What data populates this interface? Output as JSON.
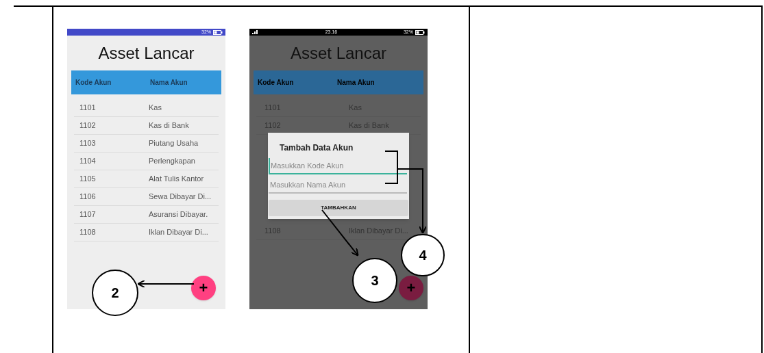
{
  "screens": [
    {
      "kind": "list",
      "status_bar": {
        "battery": "32%"
      },
      "title": "Asset Lancar",
      "columns": [
        "Kode Akun",
        "Nama Akun"
      ],
      "rows": [
        {
          "code": "1101",
          "name": "Kas"
        },
        {
          "code": "1102",
          "name": "Kas di Bank"
        },
        {
          "code": "1103",
          "name": "Piutang Usaha"
        },
        {
          "code": "1104",
          "name": "Perlengkapan"
        },
        {
          "code": "1105",
          "name": "Alat Tulis Kantor"
        },
        {
          "code": "1106",
          "name": "Sewa Dibayar Di..."
        },
        {
          "code": "1107",
          "name": "Asuransi Dibayar."
        },
        {
          "code": "1108",
          "name": "Iklan Dibayar Di..."
        }
      ],
      "fab": "+"
    },
    {
      "kind": "dialog",
      "status_bar": {
        "time": "23.16",
        "battery": "32%"
      },
      "title": "Asset Lancar",
      "columns": [
        "Kode Akun",
        "Nama Akun"
      ],
      "rows_above": [
        {
          "code": "1101",
          "name": "Kas"
        },
        {
          "code": "1102",
          "name": "Kas di Bank"
        }
      ],
      "rows_below": [
        {
          "code": "1108",
          "name": "Iklan Dibayar Di..."
        }
      ],
      "dialog": {
        "title": "Tambah Data Akun",
        "fields": [
          {
            "placeholder": "Masukkan Kode Akun",
            "focused": true
          },
          {
            "placeholder": "Masukkan Nama Akun",
            "focused": false
          }
        ],
        "button": "TAMBAHKAN"
      },
      "fab": "+"
    }
  ],
  "annotations": [
    {
      "number": "2"
    },
    {
      "number": "3"
    },
    {
      "number": "4"
    }
  ]
}
